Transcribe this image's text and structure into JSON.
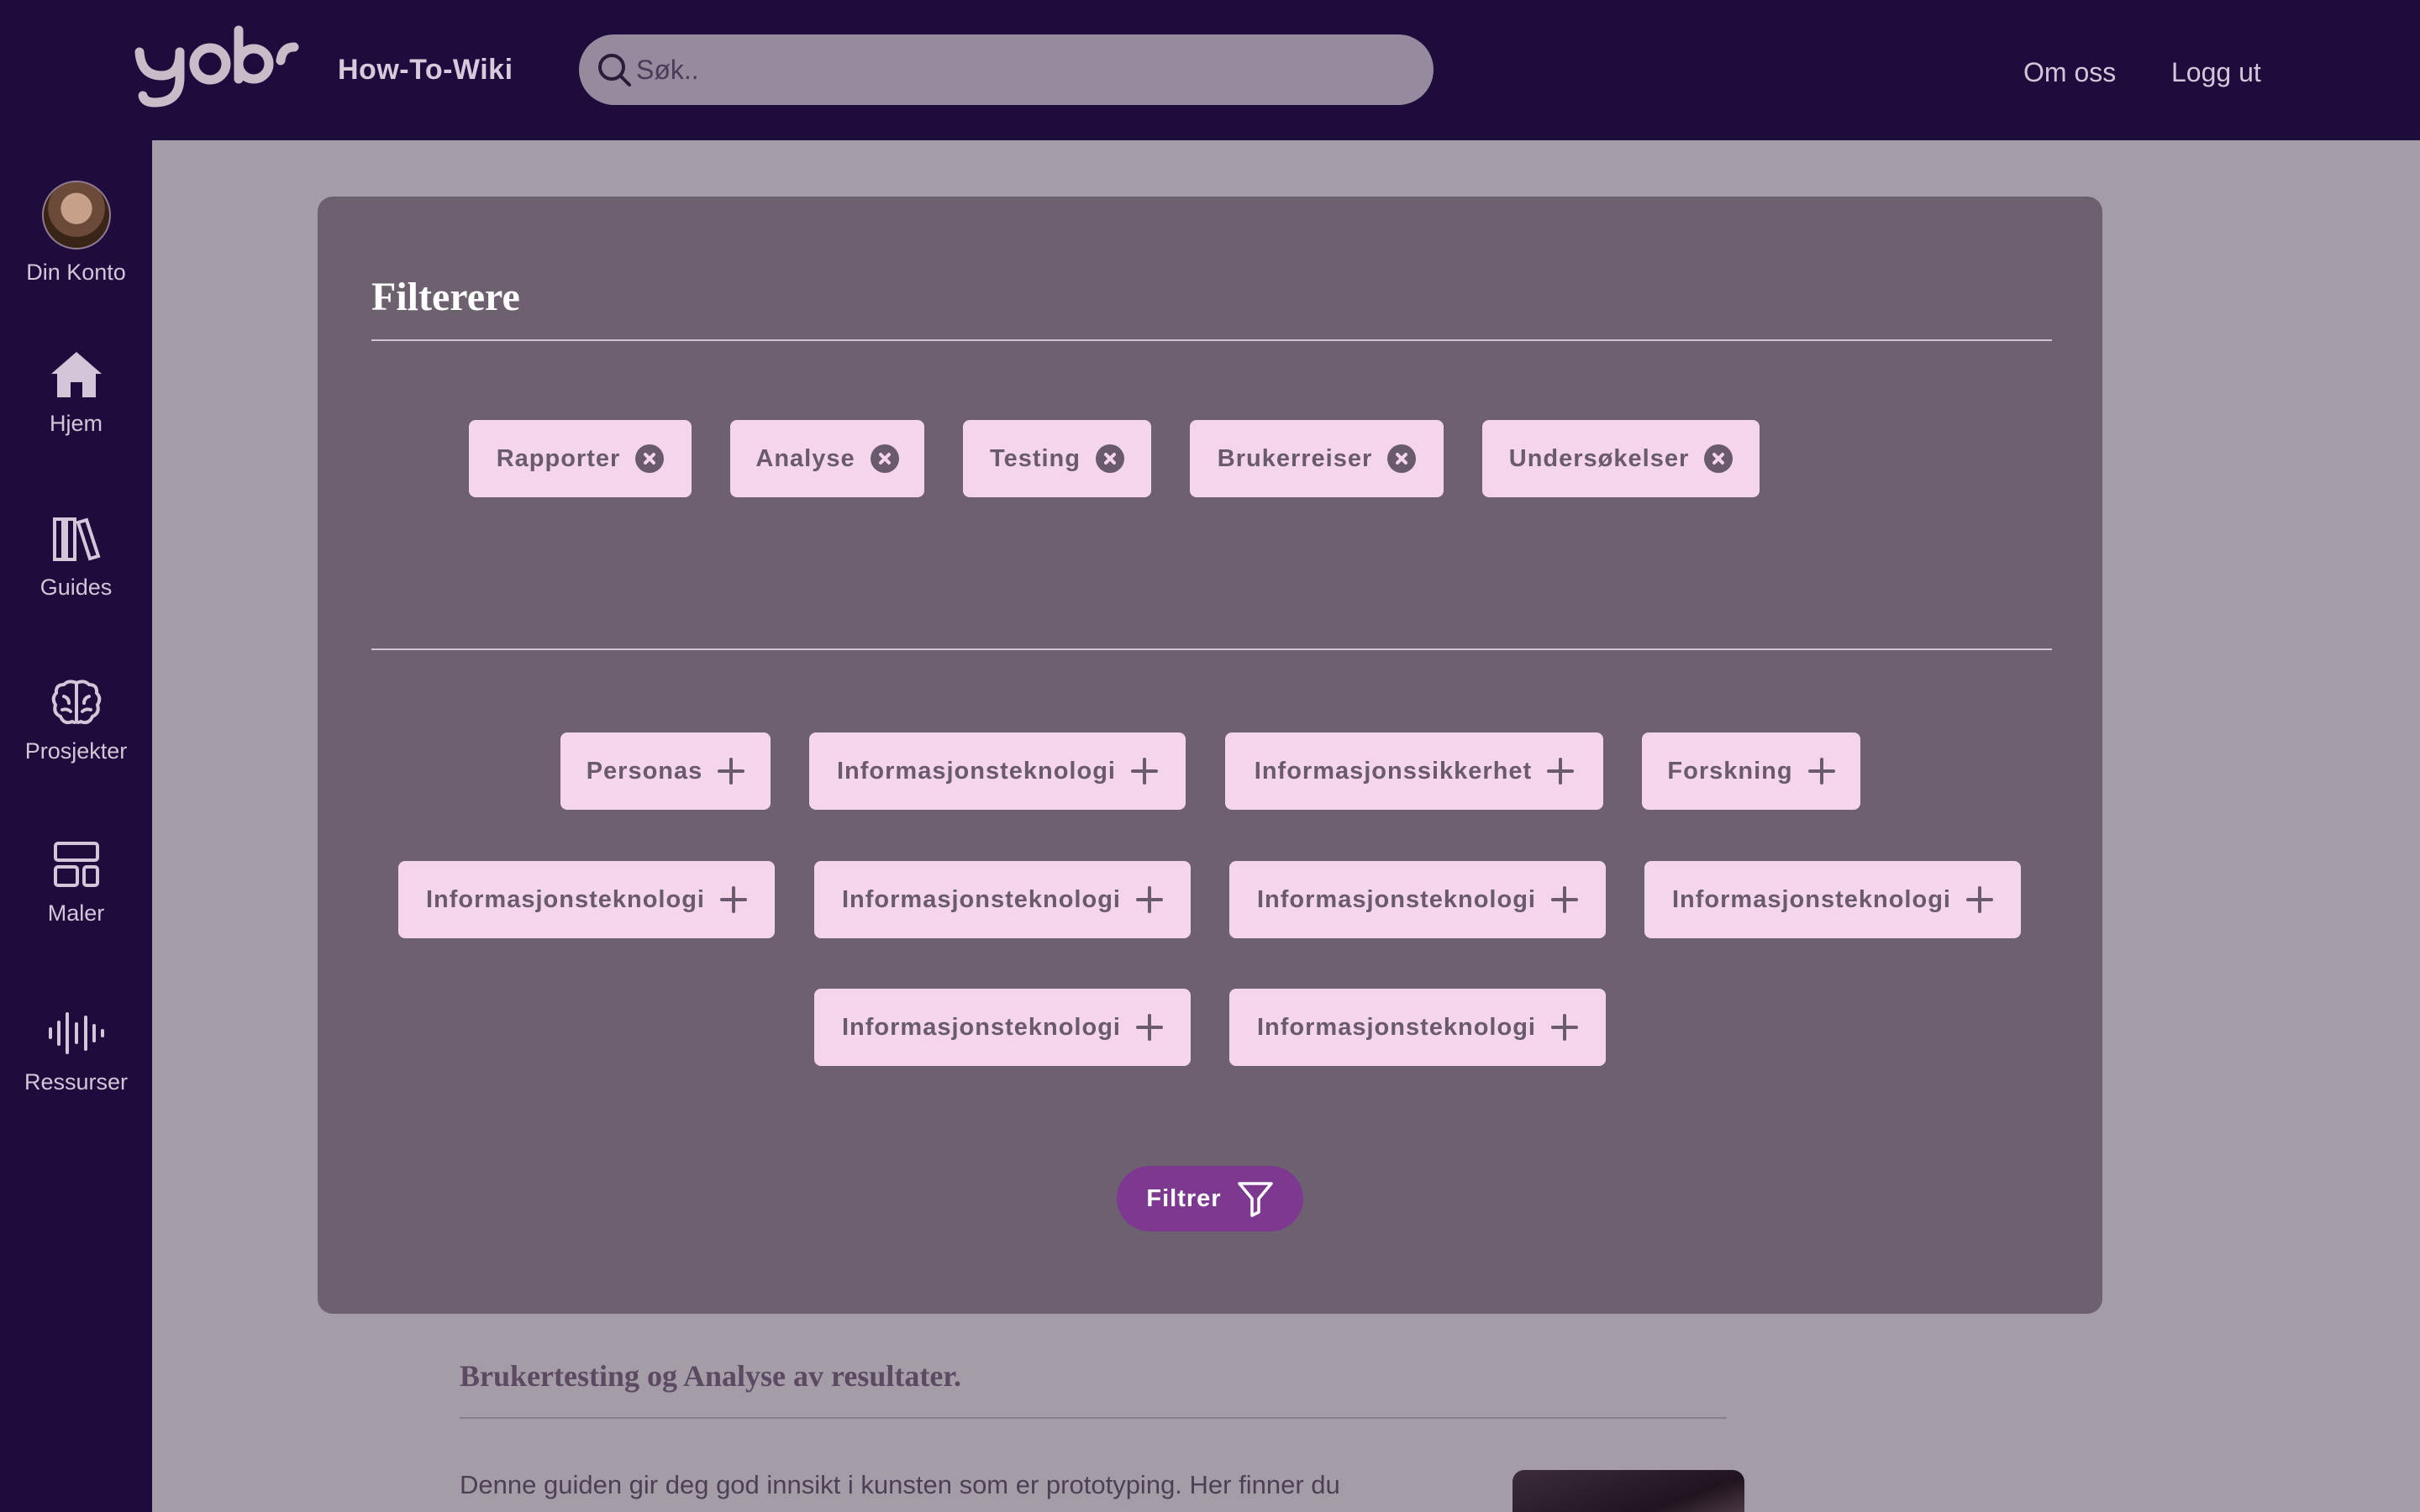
{
  "header": {
    "app_title": "How-To-Wiki",
    "search_placeholder": "Søk..",
    "nav": {
      "about": "Om oss",
      "logout": "Logg ut"
    }
  },
  "sidebar": {
    "items": [
      {
        "label": "Din Konto",
        "icon": "avatar"
      },
      {
        "label": "Hjem",
        "icon": "home-icon"
      },
      {
        "label": "Guides",
        "icon": "books-icon"
      },
      {
        "label": "Prosjekter",
        "icon": "brain-icon"
      },
      {
        "label": "Maler",
        "icon": "layout-icon"
      },
      {
        "label": "Ressurser",
        "icon": "soundwave-icon"
      }
    ]
  },
  "modal": {
    "title": "Filterere",
    "selected_filters": [
      "Rapporter",
      "Analyse",
      "Testing",
      "Brukerreiser",
      "Undersøkelser"
    ],
    "available_filters": [
      "Personas",
      "Informasjonsteknologi",
      "Informasjonssikkerhet",
      "Forskning",
      "Informasjonsteknologi",
      "Informasjonsteknologi",
      "Informasjonsteknologi",
      "Informasjonsteknologi",
      "Informasjonsteknologi",
      "Informasjonsteknologi"
    ],
    "filter_button": "Filtrer"
  },
  "background": {
    "guide_title": "Brukertesting og Analyse av resultater.",
    "guide_text": "Denne guiden gir deg god innsikt i kunsten som er prototyping. Her finner du"
  },
  "colors": {
    "navy": "#1e0c3c",
    "chip": "#f5d5ea",
    "accent": "#7d3990",
    "modal": "#6d6170"
  }
}
